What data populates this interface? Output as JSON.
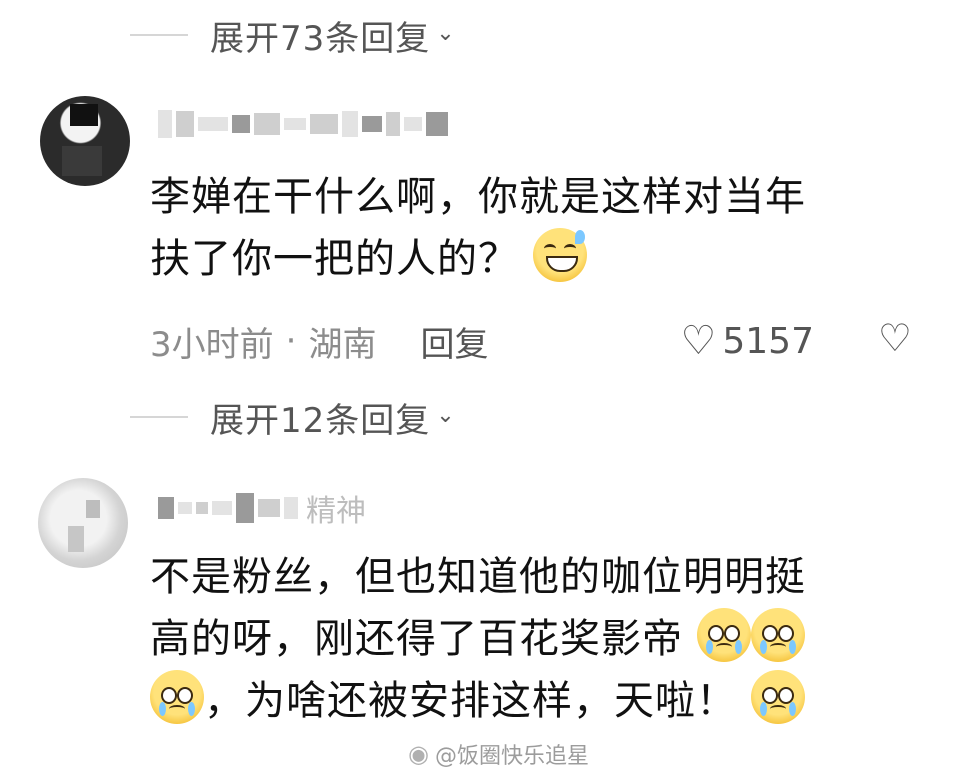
{
  "thread": {
    "expand_top": "展开73条回复",
    "expand_mid": "展开12条回复"
  },
  "comments": [
    {
      "text_line1": "李婵在干什么啊，你就是这样对当年",
      "text_line2": "扶了你一把的人的？",
      "time": "3小时前",
      "separator": "·",
      "location": "湖南",
      "reply_label": "回复",
      "likes": "5157"
    },
    {
      "name_fragment": "精神",
      "text_line1": "不是粉丝，但也知道他的咖位明明挺",
      "text_line2": "高的呀，刚还得了百花奖影帝",
      "text_line3": "，为啥还被安排这样，天啦！"
    }
  ],
  "icons": {
    "chevron": "chevron-down-icon",
    "heart": "heart-icon",
    "broken_heart": "broken-heart-icon",
    "emoji_grin_sweat": "grinning-sweat-emoji",
    "emoji_pleading": "pleading-face-emoji"
  },
  "watermark": "@饭圈快乐追星"
}
